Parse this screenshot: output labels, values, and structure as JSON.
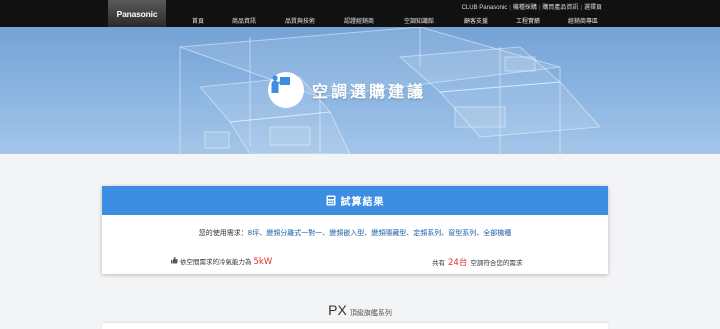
{
  "brand": "Panasonic",
  "utility_links": [
    "CLUB Panasonic",
    "機種採購",
    "購買產品資訊",
    "選擇頁"
  ],
  "nav": [
    "首頁",
    "商品資訊",
    "品質與技術",
    "認證經銷商",
    "空調知識館",
    "顧客支援",
    "工程實績",
    "經銷商專區"
  ],
  "hero": {
    "title": "空調選購建議",
    "icon": "advisor-presentation-icon"
  },
  "result": {
    "title": "試算結果",
    "icon": "calculator-icon",
    "needs_label": "您的使用需求：",
    "needs_values": "8坪、變頻分離式一對一、變頻嵌入型、變頻隱藏型、定頻系列、窗型系列、全部機種",
    "capacity_label": "依空間需求的冷氣能力為",
    "capacity_value": "5kW",
    "count_prefix": "共有",
    "count_value": "24台",
    "count_suffix": "空調符合您的需求"
  },
  "series": {
    "name": "PX",
    "subtitle": "頂級旗艦系列"
  },
  "colors": {
    "accent": "#3d8ee3",
    "highlight": "#e03030",
    "link": "#1a5fa8"
  }
}
